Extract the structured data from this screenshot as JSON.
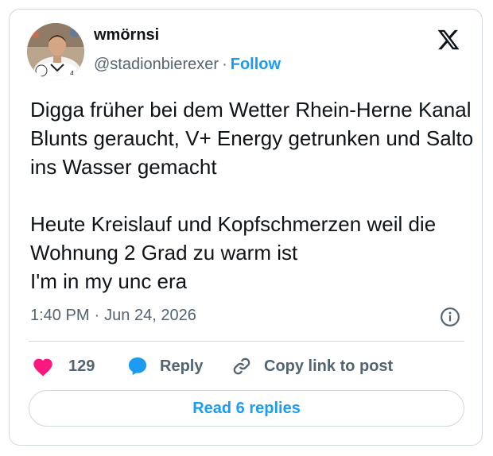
{
  "author": {
    "display_name": "wmörnsi",
    "handle": "@stadionbierexer",
    "separator": "·",
    "follow_label": "Follow"
  },
  "tweet": {
    "paragraphs": [
      "Digga früher bei dem Wetter Rhein-Herne Kanal Blunts geraucht, V+ Energy getrunken und Salto ins Wasser gemacht",
      "Heute Kreislauf und Kopfschmerzen weil die Wohnung 2 Grad zu warm ist",
      "I'm in my unc era"
    ]
  },
  "meta": {
    "time": "1:40 PM",
    "separator": "·",
    "date": "Jun 24, 2026"
  },
  "actions": {
    "like_count": "129",
    "reply_label": "Reply",
    "copy_label": "Copy link to post"
  },
  "read_replies_label": "Read 6 replies",
  "colors": {
    "accent": "#1d9bf0",
    "like": "#f91880",
    "text": "#0f1419",
    "muted": "#536471",
    "border": "#cfd9de"
  },
  "icons": [
    "x-logo-icon",
    "info-icon",
    "heart-icon",
    "reply-bubble-icon",
    "link-icon"
  ]
}
